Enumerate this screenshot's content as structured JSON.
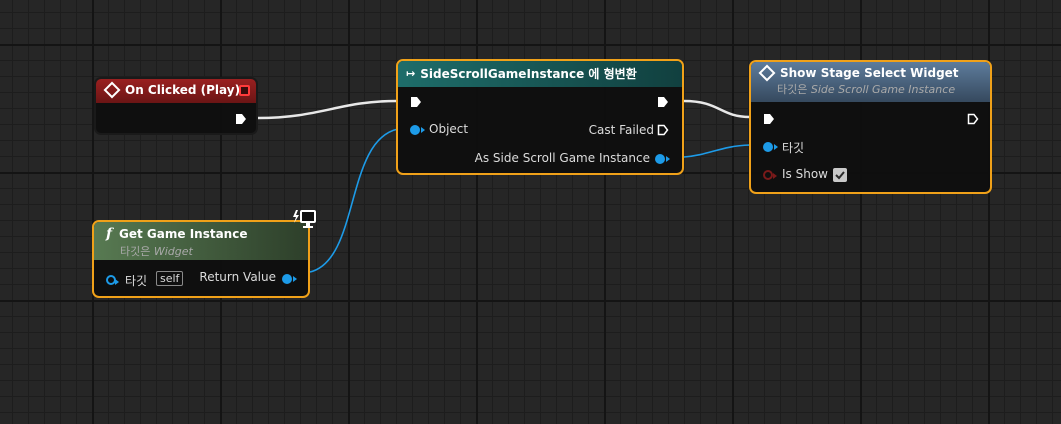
{
  "colors": {
    "event_header": "#8c1c1c",
    "cast_header": "#1e6d6a",
    "function_header": "#51704d",
    "call_header": "#4f6985",
    "selection": "#f0a119",
    "object_pin": "#1d9be8"
  },
  "nodes": {
    "on_clicked": {
      "title": "On Clicked (Play)",
      "icon": "event-diamond-icon"
    },
    "cast": {
      "title": "SideScrollGameInstance 에 형변환",
      "icon": "cast-arrow-icon",
      "object_label": "Object",
      "cast_failed_label": "Cast Failed",
      "as_label": "As Side Scroll Game Instance"
    },
    "show_stage": {
      "title": "Show Stage Select Widget",
      "subtitle_prefix": "타깃은",
      "subtitle_target": "Side Scroll Game Instance",
      "icon": "function-diamond-icon",
      "target_label": "타깃",
      "is_show_label": "Is Show",
      "is_show_checked": true
    },
    "get_game_instance": {
      "title": "Get Game Instance",
      "subtitle_prefix": "타깃은",
      "subtitle_target": "Widget",
      "icon": "function-f-icon",
      "target_label": "타깃",
      "self_label": "self",
      "return_label": "Return Value"
    }
  }
}
